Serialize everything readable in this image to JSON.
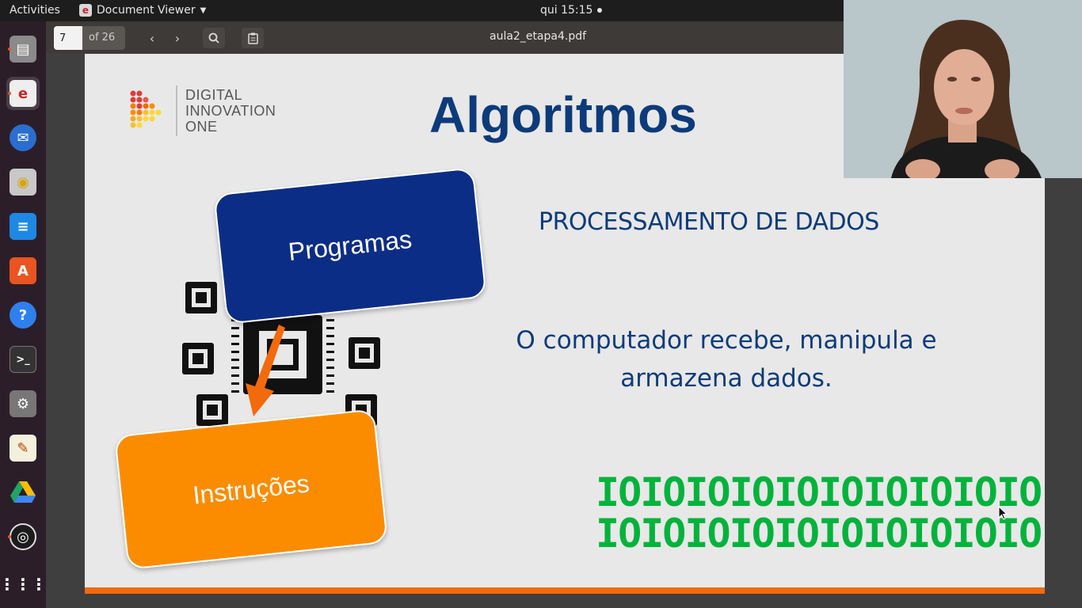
{
  "topbar": {
    "activities": "Activities",
    "app_name": "Document Viewer",
    "clock": "qui 15:15"
  },
  "dock": {
    "items": [
      "files-icon",
      "document-viewer-icon",
      "thunderbird-icon",
      "rhythmbox-icon",
      "libreoffice-writer-icon",
      "software-center-icon",
      "help-icon",
      "terminal-icon",
      "settings-icon",
      "text-editor-icon",
      "google-drive-icon",
      "obs-icon",
      "show-apps-icon"
    ]
  },
  "viewer": {
    "page_value": "7",
    "page_of": "of 26",
    "filename": "aula2_etapa4.pdf"
  },
  "slide": {
    "logo_line1": "DIGITAL",
    "logo_line2": "INNOVATION",
    "logo_line3": "ONE",
    "title": "Algoritmos",
    "section": "PROCESSAMENTO DE DADOS",
    "body_line1": "O computador recebe, manipula e",
    "body_line2": "armazena dados.",
    "card_top": "Programas",
    "card_bottom": "Instruções",
    "binary_line1": "IOIOIOIOIOIOIOIOIOIO",
    "binary_line2": "IOIOIOIOIOIOIOIOIOIO",
    "colors": {
      "title": "#0d3b7a",
      "card_top": "#0c2d85",
      "card_bottom": "#fb8c00",
      "binary": "#00b33c",
      "accent_bar": "#f26a0c"
    }
  }
}
